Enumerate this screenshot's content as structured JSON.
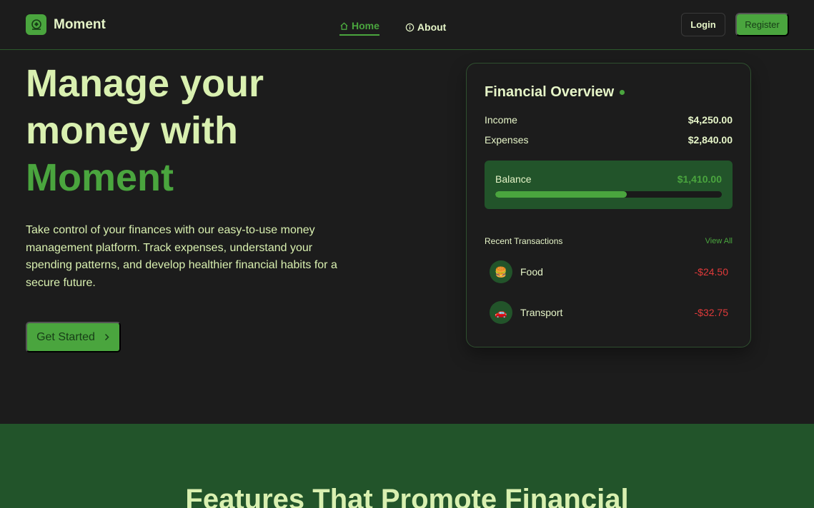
{
  "nav": {
    "brand": "Moment",
    "links": [
      {
        "label": "Home",
        "icon": "home-icon",
        "active": true
      },
      {
        "label": "About",
        "icon": "info-icon",
        "active": false
      }
    ],
    "login": "Login",
    "register": "Register"
  },
  "hero": {
    "title_line1": "Manage your",
    "title_line2": "money with",
    "title_accent": "Moment",
    "description": "Take control of your finances with our easy-to-use money management platform. Track expenses, understand your spending patterns, and develop healthier financial habits for a secure future.",
    "cta": "Get Started"
  },
  "overview": {
    "title": "Financial Overview",
    "income_label": "Income",
    "income": "$4,250.00",
    "expenses_label": "Expenses",
    "expenses": "$2,840.00",
    "balance_label": "Balance",
    "balance": "$1,410.00",
    "balance_progress": 0.58,
    "recent_title": "Recent Transactions",
    "view_all": "View All",
    "transactions": [
      {
        "icon": "🍔",
        "icon_name": "burger-icon",
        "name": "Food",
        "amount": "-$24.50"
      },
      {
        "icon": "🚗",
        "icon_name": "car-icon",
        "name": "Transport",
        "amount": "-$32.75"
      }
    ]
  },
  "features": {
    "title": "Features That Promote Financial"
  },
  "colors": {
    "background": "#1c1c1c",
    "accent": "#4aa53e",
    "text": "#d9f0b0",
    "panel": "#22542a",
    "negative": "#e03a3a"
  }
}
